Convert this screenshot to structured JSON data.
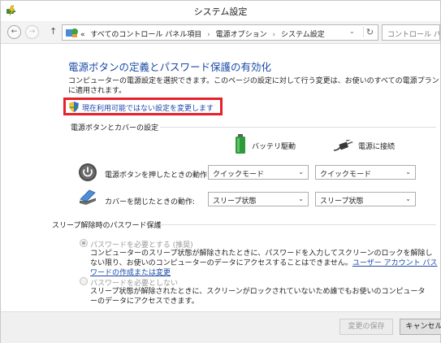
{
  "window": {
    "title": "システム設定"
  },
  "navigation": {
    "back_label": "←",
    "forward_label": "→",
    "up_label": "↑",
    "breadcrumbs": [
      "«",
      "すべてのコントロール パネル項目",
      "電源オプション",
      "システム設定"
    ],
    "dropdown_glyph": "⌄",
    "refresh_label": "↻",
    "search_placeholder": "コントロール パネル"
  },
  "page": {
    "title": "電源ボタンの定義とパスワード保護の有効化",
    "description": "コンピューターの電源設定を選択できます。このページの設定に対して行う変更は、お使いのすべての電源プランに適用されます。",
    "change_link": "現在利用可能ではない設定を変更します"
  },
  "power_section": {
    "label": "電源ボタンとカバーの設定",
    "columns": {
      "battery": "バッテリ駆動",
      "plugged": "電源に接続"
    },
    "rows": [
      {
        "label": "電源ボタンを押したときの動作:",
        "battery_value": "クイックモード",
        "plugged_value": "クイックモード",
        "arrow": "⌄"
      },
      {
        "label": "カバーを閉じたときの動作:",
        "battery_value": "スリープ状態",
        "plugged_value": "スリープ状態",
        "arrow": "⌄"
      }
    ]
  },
  "password_section": {
    "label": "スリープ解除時のパスワード保護",
    "option_require": {
      "label": "パスワードを必要とする (推奨)",
      "description": "コンピューターのスリープ状態が解除されたときに、パスワードを入力してスクリーンのロックを解除しない限り、お使いのコンピューターのデータにアクセスすることはできません。",
      "link": "ユーザー アカウント パスワードの作成または変更",
      "selected": true
    },
    "option_no_require": {
      "label": "パスワードを必要としない",
      "description": "スリープ状態が解除されたときに、スクリーンがロックされていないため誰でもお使いのコンピューターのデータにアクセスできます。",
      "selected": false
    }
  },
  "footer": {
    "save_label": "変更の保存",
    "cancel_label": "キャンセル"
  },
  "colors": {
    "link": "#1a4aa8",
    "highlight_box": "#e8202a"
  }
}
